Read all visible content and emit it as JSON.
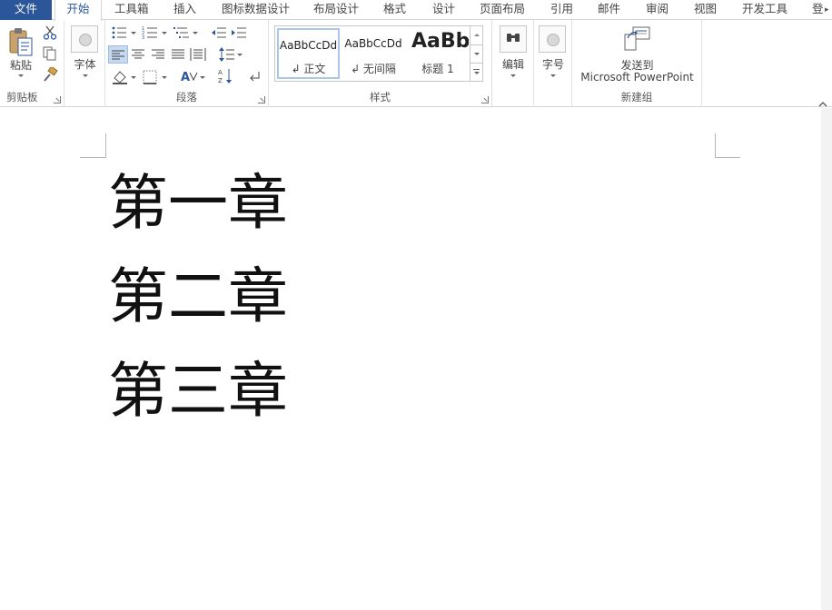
{
  "tabs": [
    {
      "label": "文件"
    },
    {
      "label": "开始"
    },
    {
      "label": "工具箱"
    },
    {
      "label": "插入"
    },
    {
      "label": "图标数据设计"
    },
    {
      "label": "布局设计"
    },
    {
      "label": "格式"
    },
    {
      "label": "设计"
    },
    {
      "label": "页面布局"
    },
    {
      "label": "引用"
    },
    {
      "label": "邮件"
    },
    {
      "label": "审阅"
    },
    {
      "label": "视图"
    },
    {
      "label": "开发工具"
    },
    {
      "label": "登"
    }
  ],
  "active_tab": "开始",
  "ribbon": {
    "clipboard": {
      "paste_label": "粘贴",
      "group_label": "剪贴板"
    },
    "font": {
      "font_label": "字体"
    },
    "paragraph": {
      "group_label": "段落"
    },
    "styles": {
      "group_label": "样式",
      "items": [
        {
          "sample": "AaBbCcDd",
          "name": "↲ 正文"
        },
        {
          "sample": "AaBbCcDd",
          "name": "↲ 无间隔"
        },
        {
          "sample": "AaBb",
          "name": "标题 1"
        }
      ]
    },
    "editing": {
      "label": "编辑"
    },
    "fontsize": {
      "label": "字号"
    },
    "newgroup": {
      "send_line1": "发送到",
      "send_line2": "Microsoft PowerPoint",
      "group_label": "新建组"
    }
  },
  "document": {
    "lines": [
      "第一章",
      "第二章",
      "第三章"
    ]
  },
  "colors": {
    "accent": "#2b579a",
    "selected_style_border": "#aac6ea"
  }
}
